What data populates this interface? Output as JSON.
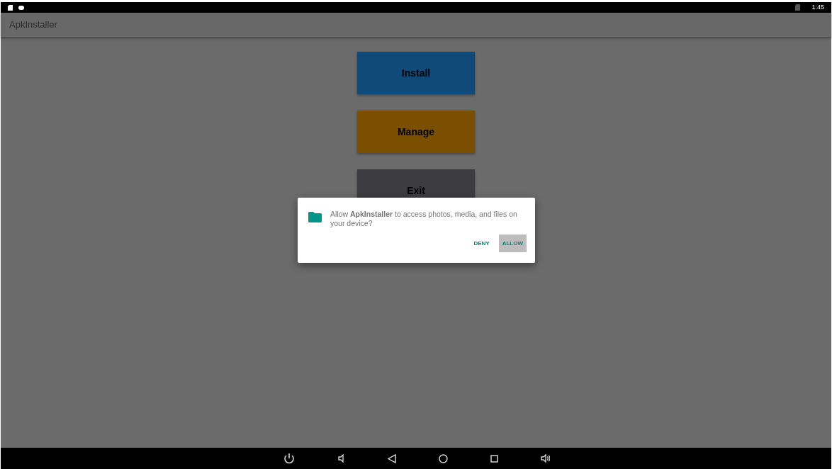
{
  "status_bar": {
    "time": "1:45"
  },
  "app_bar": {
    "title": "ApkInstaller"
  },
  "buttons": [
    {
      "label": "Install",
      "color": "#0f4a78"
    },
    {
      "label": "Manage",
      "color": "#7a5000"
    },
    {
      "label": "Exit",
      "color": "#3d3d3f"
    }
  ],
  "dialog": {
    "message": "Allow **ApkInstaller** to access photos, media, and files on your device?",
    "actions": [
      {
        "label": "DENY",
        "focused": false
      },
      {
        "label": "ALLOW",
        "focused": true
      }
    ]
  }
}
